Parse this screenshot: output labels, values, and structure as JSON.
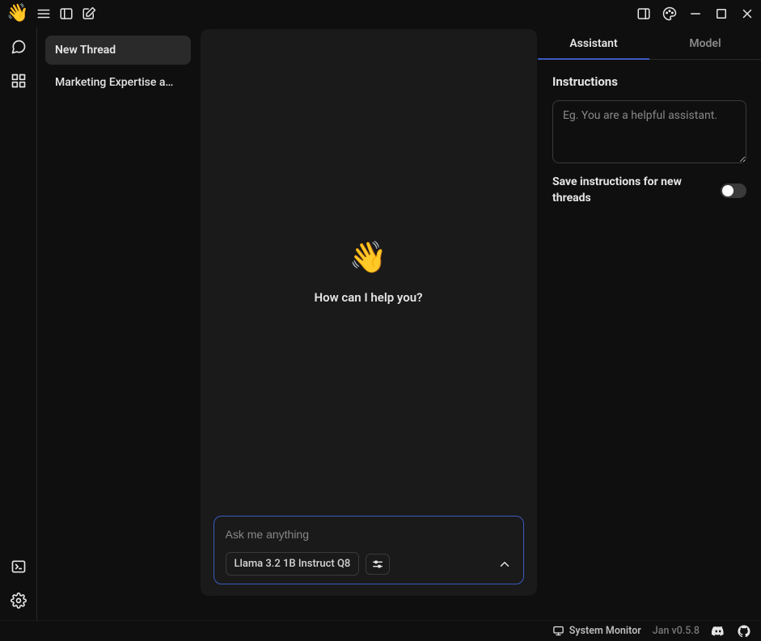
{
  "threads": {
    "items": [
      {
        "label": "New Thread",
        "active": true
      },
      {
        "label": "Marketing Expertise a…",
        "active": false
      }
    ]
  },
  "chat": {
    "greeting": "How can I help you?",
    "input_placeholder": "Ask me anything",
    "model_label": "Llama 3.2 1B Instruct Q8"
  },
  "right_panel": {
    "tabs": {
      "assistant": "Assistant",
      "model": "Model"
    },
    "instructions_label": "Instructions",
    "instructions_placeholder": "Eg. You are a helpful assistant.",
    "save_toggle_label": "Save instructions for new threads"
  },
  "statusbar": {
    "system_monitor": "System Monitor",
    "version": "Jan v0.5.8"
  }
}
